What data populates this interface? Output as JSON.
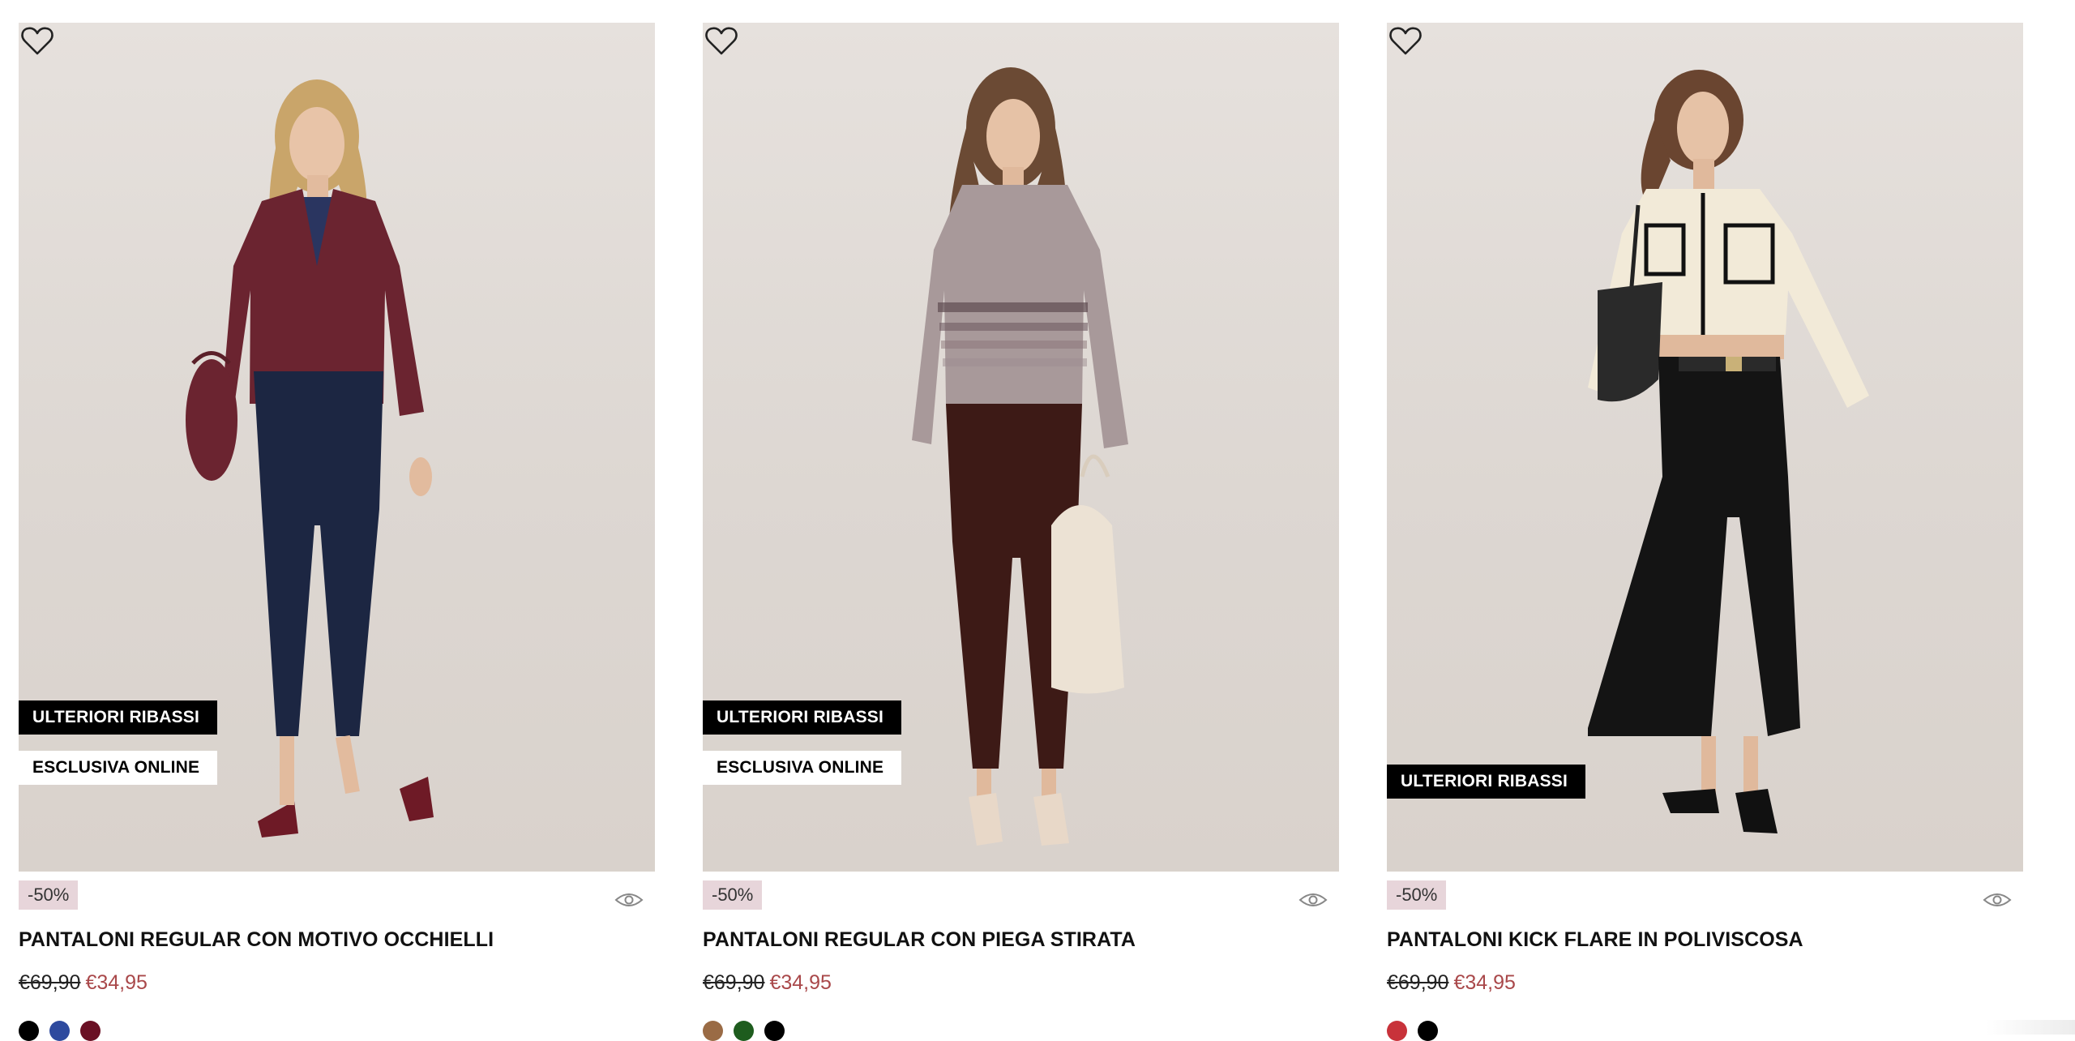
{
  "products": [
    {
      "tags": [
        "ULTERIORI RIBASSI",
        "ESCLUSIVA ONLINE"
      ],
      "discount": "-50%",
      "name": "PANTALONI REGULAR CON MOTIVO OCCHIELLI",
      "old_price": "€69,90",
      "new_price": "€34,95",
      "swatches": [
        "#000000",
        "#2e4a9e",
        "#6a1024"
      ],
      "icons": {
        "wishlist": "heart-outline-icon",
        "quick_view": "eye-icon"
      },
      "photo": {
        "top": "#6b2430",
        "bottoms": "#1c2642",
        "shoes": "#6e1a26",
        "bag": "#6b2430"
      }
    },
    {
      "tags": [
        "ULTERIORI RIBASSI",
        "ESCLUSIVA ONLINE"
      ],
      "discount": "-50%",
      "name": "PANTALONI REGULAR CON PIEGA STIRATA",
      "old_price": "€69,90",
      "new_price": "€34,95",
      "swatches": [
        "#9a6b45",
        "#1e5c1e",
        "#000000"
      ],
      "icons": {
        "wishlist": "heart-outline-icon",
        "quick_view": "eye-icon"
      },
      "photo": {
        "top": "#a8999a",
        "bottoms": "#3d1a16",
        "shoes": "#e8d8c8",
        "bag": "#ece2d4"
      }
    },
    {
      "tags": [
        "ULTERIORI RIBASSI"
      ],
      "discount": "-50%",
      "name": "PANTALONI KICK FLARE IN POLIVISCOSA",
      "old_price": "€69,90",
      "new_price": "€34,95",
      "swatches": [
        "#c8323a",
        "#000000"
      ],
      "icons": {
        "wishlist": "heart-outline-icon",
        "quick_view": "eye-icon"
      },
      "photo": {
        "top": "#f2ead8",
        "bottoms": "#141414",
        "shoes": "#111111",
        "bag": "#2a2a2a"
      }
    }
  ]
}
